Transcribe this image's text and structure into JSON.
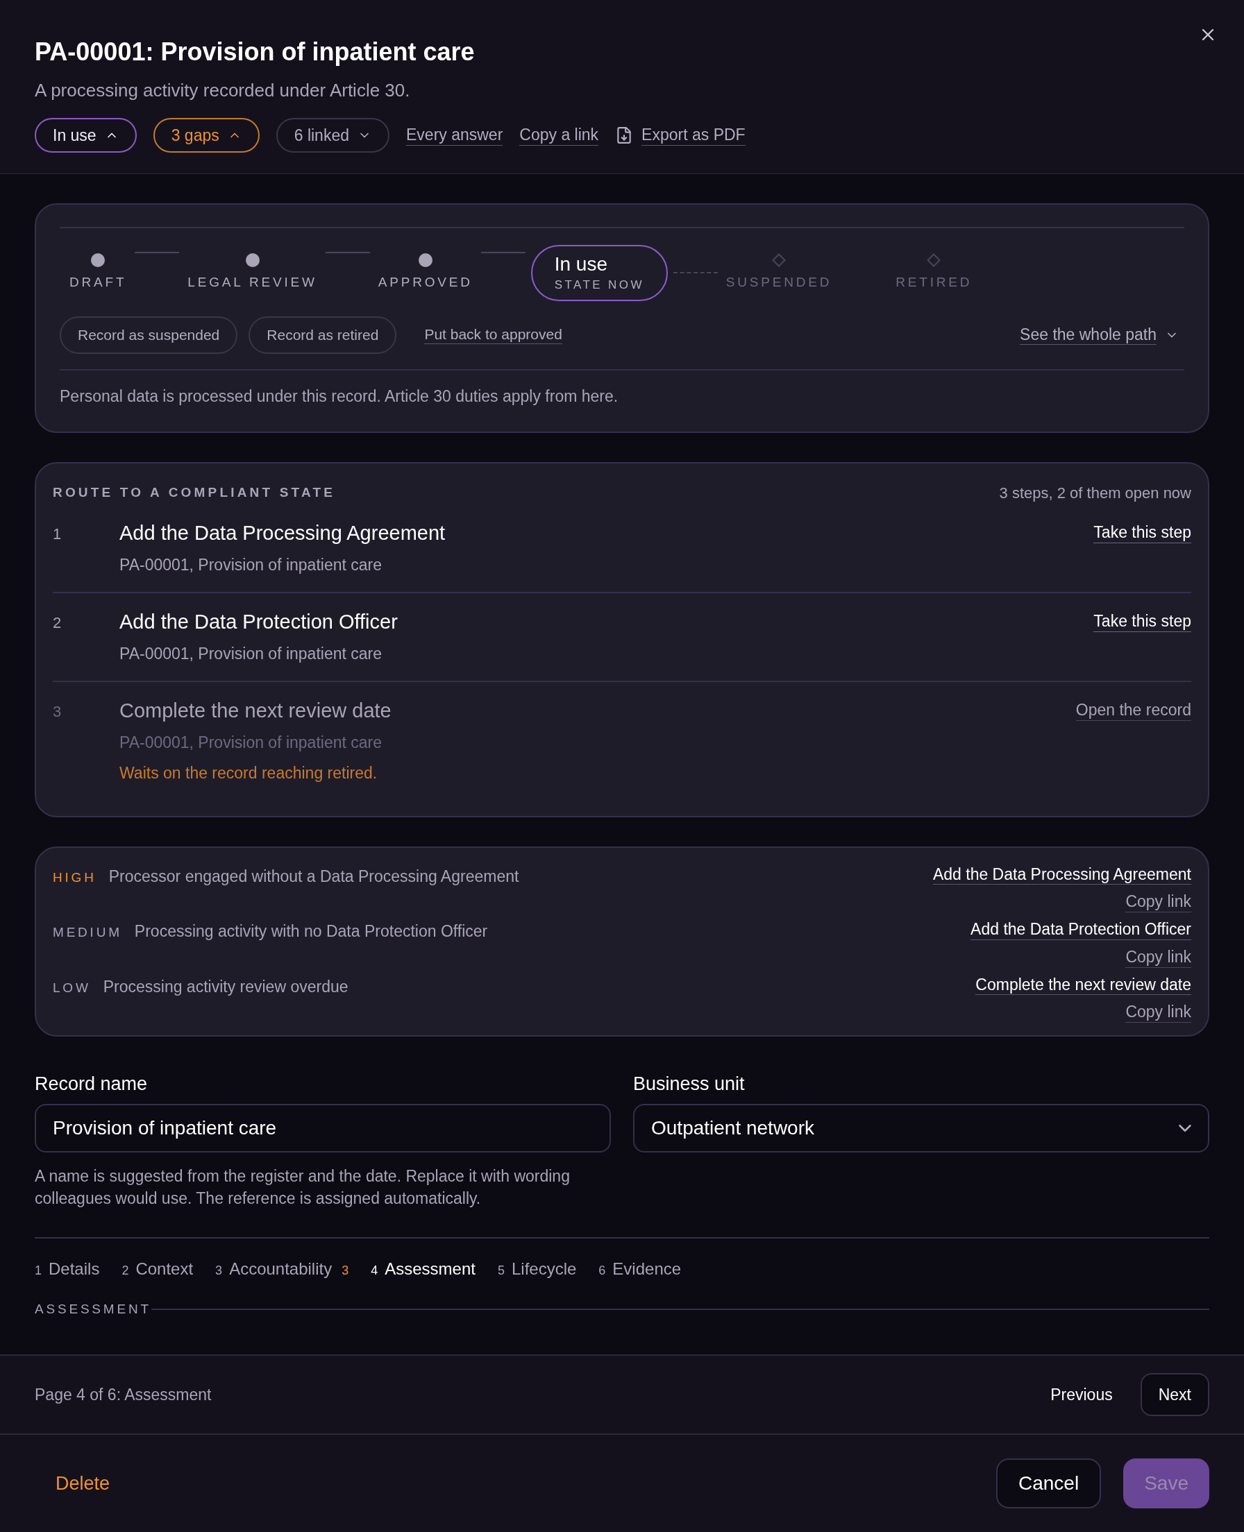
{
  "dialog": {
    "title": "PA-00001: Provision of inpatient care",
    "subtitle": "A processing activity recorded under Article 30."
  },
  "chips": [
    {
      "label": "In use",
      "kind": "status",
      "expanded": true
    },
    {
      "label": "3 gaps",
      "kind": "warning",
      "expanded": true
    },
    {
      "label": "6 linked",
      "kind": "plain",
      "expanded": false
    }
  ],
  "links": [
    {
      "label": "Every answer",
      "kind": "text"
    },
    {
      "label": "Copy a link",
      "kind": "text"
    },
    {
      "label": "Export as PDF",
      "kind": "download"
    }
  ],
  "lifecycle": {
    "steps": [
      {
        "label": "DRAFT",
        "kind": "done"
      },
      {
        "label": "LEGAL REVIEW",
        "kind": "done"
      },
      {
        "label": "APPROVED",
        "kind": "done"
      },
      {
        "label": "In use",
        "caption": "STATE NOW",
        "kind": "current"
      },
      {
        "label": "SUSPENDED",
        "kind": "future"
      },
      {
        "label": "RETIRED",
        "kind": "future"
      }
    ],
    "actions": [
      {
        "label": "Record as suspended",
        "kind": "button"
      },
      {
        "label": "Record as retired",
        "kind": "button"
      },
      {
        "label": "Put back to approved",
        "kind": "link"
      }
    ],
    "path_toggle": {
      "label": "See the whole path",
      "expanded": false
    },
    "note": "Personal data is processed under this record. Article 30 duties apply from here."
  },
  "route": {
    "title": "ROUTE TO A COMPLIANT STATE",
    "summary": "3 steps, 2 of them open now",
    "steps": [
      {
        "number": "1",
        "title": "Add the Data Processing Agreement",
        "subtitle": "PA-00001, Provision of inpatient care",
        "action": "Take this step",
        "open": true
      },
      {
        "number": "2",
        "title": "Add the Data Protection Officer",
        "subtitle": "PA-00001, Provision of inpatient care",
        "action": "Take this step",
        "open": true
      },
      {
        "number": "3",
        "title": "Complete the next review date",
        "subtitle": "PA-00001, Provision of inpatient care",
        "action": "Open the record",
        "open": false,
        "note": "Waits on the record reaching retired."
      }
    ]
  },
  "gaps": [
    {
      "severity": "HIGH",
      "color": "#f0922e",
      "text": "Processor engaged without a Data Processing Agreement",
      "action": "Add the Data Processing Agreement",
      "copy": "Copy link"
    },
    {
      "severity": "MEDIUM",
      "color": "#a8a3b8",
      "text": "Processing activity with no Data Protection Officer",
      "action": "Add the Data Protection Officer",
      "copy": "Copy link"
    },
    {
      "severity": "LOW",
      "color": "#a8a3b8",
      "text": "Processing activity review overdue",
      "action": "Complete the next review date",
      "copy": "Copy link"
    }
  ],
  "fields": [
    {
      "label": "Record name",
      "kind": "text",
      "value": "Provision of inpatient care",
      "help": "A name is suggested from the register and the date. Replace it with wording colleagues would use. The reference is assigned automatically."
    },
    {
      "label": "Business unit",
      "kind": "select",
      "value": "Outpatient network"
    }
  ],
  "tabs": [
    {
      "number": "1",
      "label": "Details",
      "selected": false
    },
    {
      "number": "2",
      "label": "Context",
      "selected": false
    },
    {
      "number": "3",
      "label": "Accountability",
      "badge": "3",
      "selected": false
    },
    {
      "number": "4",
      "label": "Assessment",
      "selected": true
    },
    {
      "number": "5",
      "label": "Lifecycle",
      "selected": false
    },
    {
      "number": "6",
      "label": "Evidence",
      "selected": false
    }
  ],
  "section_title": "ASSESSMENT",
  "pagination": {
    "label": "Page 4 of 6: Assessment",
    "buttons": [
      {
        "label": "Previous",
        "kind": "ghost"
      },
      {
        "label": "Next",
        "kind": "outline"
      }
    ]
  },
  "footer": {
    "delete": "Delete",
    "cancel": "Cancel",
    "save": {
      "label": "Save",
      "disabled": true
    }
  }
}
